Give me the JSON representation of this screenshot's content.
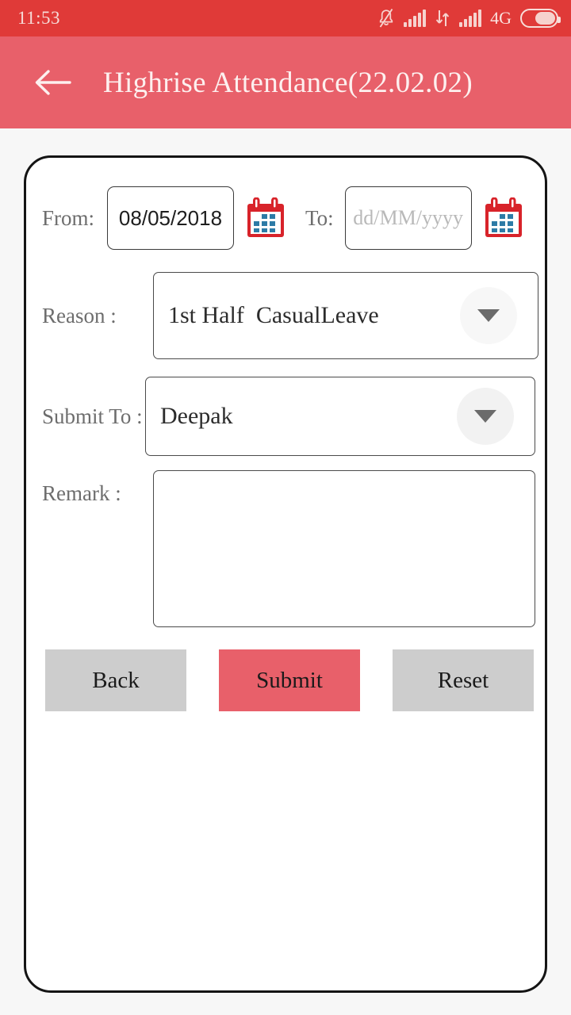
{
  "status_bar": {
    "time": "11:53",
    "network_label": "4G",
    "icons": [
      "bell-off-icon",
      "signal-bars-icon",
      "data-transfer-icon",
      "signal-bars-icon",
      "battery-icon"
    ],
    "background_color": "#e03a38",
    "battery_level_percent": 62
  },
  "app_bar": {
    "back_icon": "back-arrow-icon",
    "title": "Highrise Attendance(22.02.02)",
    "background_color": "#e8606a"
  },
  "form": {
    "from": {
      "label": "From:",
      "value": "08/05/2018",
      "calendar_icon": "calendar-icon"
    },
    "to": {
      "label": "To:",
      "value": "",
      "placeholder": "dd/MM/yyyy",
      "calendar_icon": "calendar-icon"
    },
    "reason": {
      "label": "Reason :",
      "value": "1st Half  CasualLeave",
      "dropdown_icon": "chevron-down-icon"
    },
    "submit_to": {
      "label": "Submit To :",
      "value": "Deepak",
      "dropdown_icon": "chevron-down-icon"
    },
    "remark": {
      "label": "Remark :",
      "value": "",
      "placeholder": ""
    }
  },
  "buttons": {
    "back": "Back",
    "submit": "Submit",
    "reset": "Reset",
    "grey_color": "#cdcdcd",
    "submit_color": "#e8606a"
  }
}
